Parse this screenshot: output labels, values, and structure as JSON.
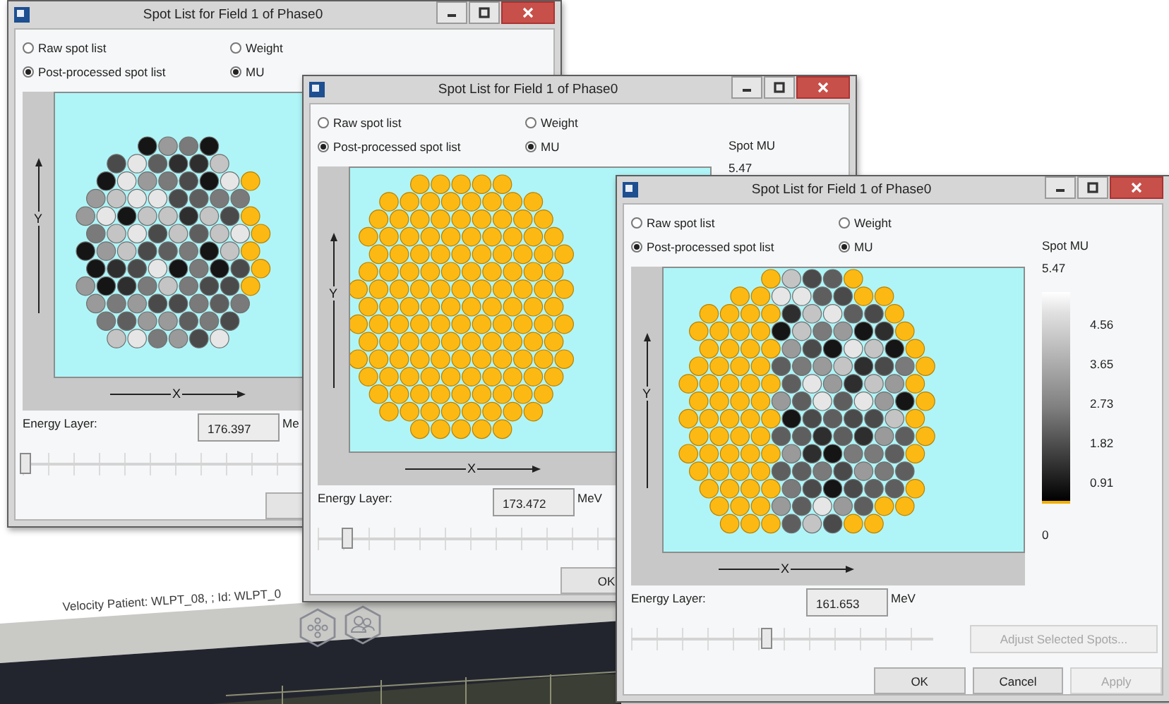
{
  "background_app": {
    "title": "Velocity Patient: WLPT_08, ; Id: WLPT_0"
  },
  "windows": [
    {
      "title": "Spot List for Field 1 of Phase0",
      "source_options": [
        {
          "label": "Raw spot list",
          "selected": false
        },
        {
          "label": "Post-processed spot list",
          "selected": true
        }
      ],
      "display_options": [
        {
          "label": "Weight",
          "selected": false
        },
        {
          "label": "MU",
          "selected": true
        }
      ],
      "plot": {
        "y_label": "Y",
        "x_label": "X"
      },
      "energy": {
        "label": "Energy Layer:",
        "value": "176.397",
        "unit": "Me"
      },
      "slider": {
        "level": 0.01
      },
      "buttons": [
        {
          "disabled": false
        }
      ]
    },
    {
      "title": "Spot List for Field 1 of Phase0",
      "source_options": [
        {
          "label": "Raw spot list",
          "selected": false
        },
        {
          "label": "Post-processed spot list",
          "selected": true
        }
      ],
      "display_options": [
        {
          "label": "Weight",
          "selected": false
        },
        {
          "label": "MU",
          "selected": true
        }
      ],
      "plot": {
        "y_label": "Y",
        "x_label": "X"
      },
      "colorbar": {
        "title": "Spot MU",
        "labels": [
          "5.47"
        ]
      },
      "energy": {
        "label": "Energy Layer:",
        "value": "173.472",
        "unit": "MeV"
      },
      "slider": {
        "level": 0.1
      },
      "buttons": [
        {
          "label": "OK",
          "disabled": false
        }
      ]
    },
    {
      "title": "Spot List for Field 1 of Phase0",
      "source_options": [
        {
          "label": "Raw spot list",
          "selected": false
        },
        {
          "label": "Post-processed spot list",
          "selected": true
        }
      ],
      "display_options": [
        {
          "label": "Weight",
          "selected": false
        },
        {
          "label": "MU",
          "selected": true
        }
      ],
      "plot": {
        "y_label": "Y",
        "x_label": "X"
      },
      "colorbar": {
        "title": "Spot MU",
        "labels": [
          "5.47",
          "4.56",
          "3.65",
          "2.73",
          "1.82",
          "0.91",
          "0"
        ]
      },
      "energy": {
        "label": "Energy Layer:",
        "value": "161.653",
        "unit": "MeV"
      },
      "slider": {
        "level": 0.45
      },
      "adjust_button": {
        "label": "Adjust Selected Spots...",
        "disabled": true
      },
      "buttons": [
        {
          "label": "OK",
          "disabled": false
        },
        {
          "label": "Cancel",
          "disabled": false
        },
        {
          "label": "Apply",
          "disabled": true
        }
      ]
    }
  ]
}
